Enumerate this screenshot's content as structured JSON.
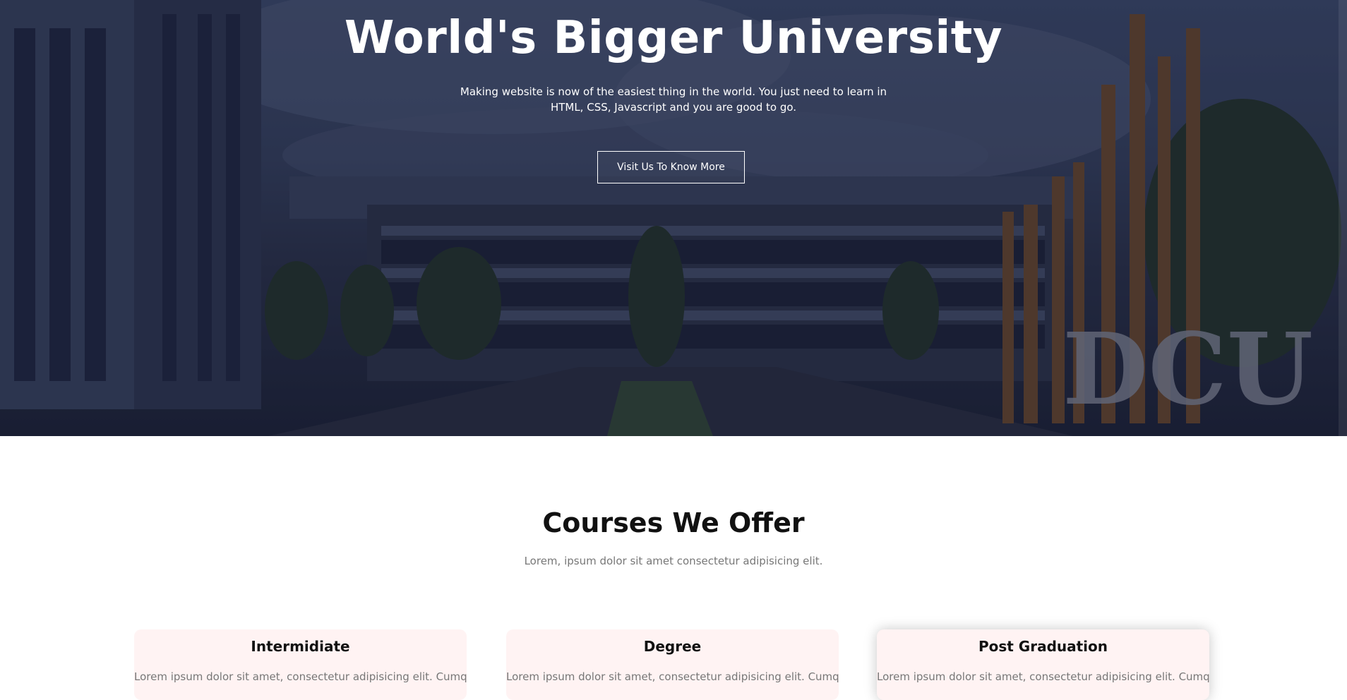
{
  "hero": {
    "title": "World's Bigger University",
    "subtitle": "Making website is now of the easiest thing in the world. You just need to learn in HTML, CSS, Javascript and you are good to go.",
    "button_label": "Visit Us To Know More",
    "sign_text": "DCU"
  },
  "courses": {
    "title": "Courses We Offer",
    "subtitle": "Lorem, ipsum dolor sit amet consectetur adipisicing elit.",
    "cards": [
      {
        "title": "Intermidiate",
        "text": "Lorem ipsum dolor sit amet, consectetur adipisicing elit. Cumque"
      },
      {
        "title": "Degree",
        "text": "Lorem ipsum dolor sit amet, consectetur adipisicing elit. Cumque"
      },
      {
        "title": "Post Graduation",
        "text": "Lorem ipsum dolor sit amet, consectetur adipisicing elit. Cumque"
      }
    ]
  },
  "colors": {
    "overlay": "#141830",
    "card_bg": "#fff3f3",
    "heading": "#111111",
    "muted": "#777777"
  }
}
